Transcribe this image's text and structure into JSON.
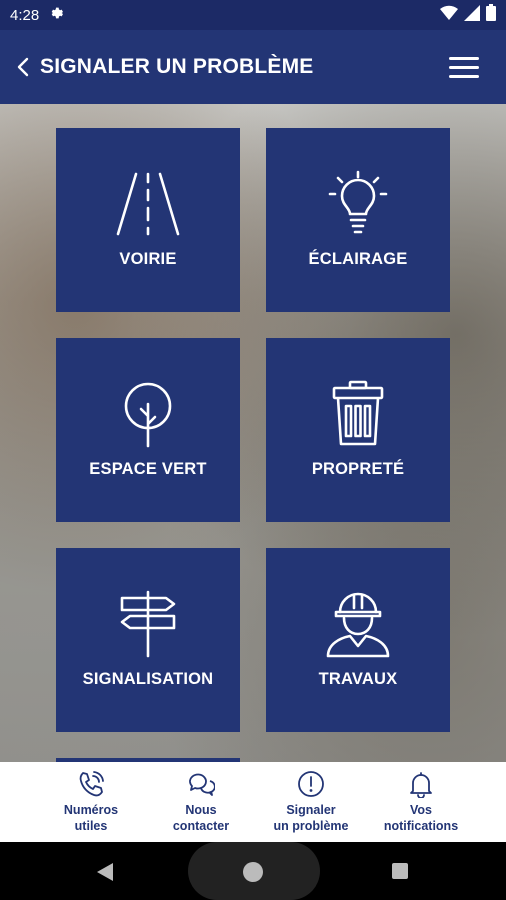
{
  "status_bar": {
    "time": "4:28",
    "icons": [
      "settings-icon",
      "wifi-icon",
      "signal-icon",
      "battery-icon"
    ]
  },
  "app_bar": {
    "title": "SIGNALER UN PROBLÈME",
    "back_icon": "chevron-left-icon",
    "menu_icon": "hamburger-menu-icon"
  },
  "categories": [
    {
      "label": "VOIRIE",
      "icon": "road-icon"
    },
    {
      "label": "ÉCLAIRAGE",
      "icon": "lightbulb-icon"
    },
    {
      "label": "ESPACE VERT",
      "icon": "tree-icon"
    },
    {
      "label": "PROPRETÉ",
      "icon": "trash-bin-icon"
    },
    {
      "label": "SIGNALISATION",
      "icon": "signpost-icon"
    },
    {
      "label": "TRAVAUX",
      "icon": "construction-worker-icon"
    }
  ],
  "bottom_nav": [
    {
      "label": "Numéros\nutiles",
      "icon": "phone-icon"
    },
    {
      "label": "Nous\ncontacter",
      "icon": "chat-bubbles-icon"
    },
    {
      "label": "Signaler\nun problème",
      "icon": "alert-circle-icon"
    },
    {
      "label": "Vos\nnotifications",
      "icon": "bell-icon"
    }
  ],
  "colors": {
    "brand": "#233575",
    "status_bar": "#1c2a66",
    "nav_background": "#ffffff"
  }
}
